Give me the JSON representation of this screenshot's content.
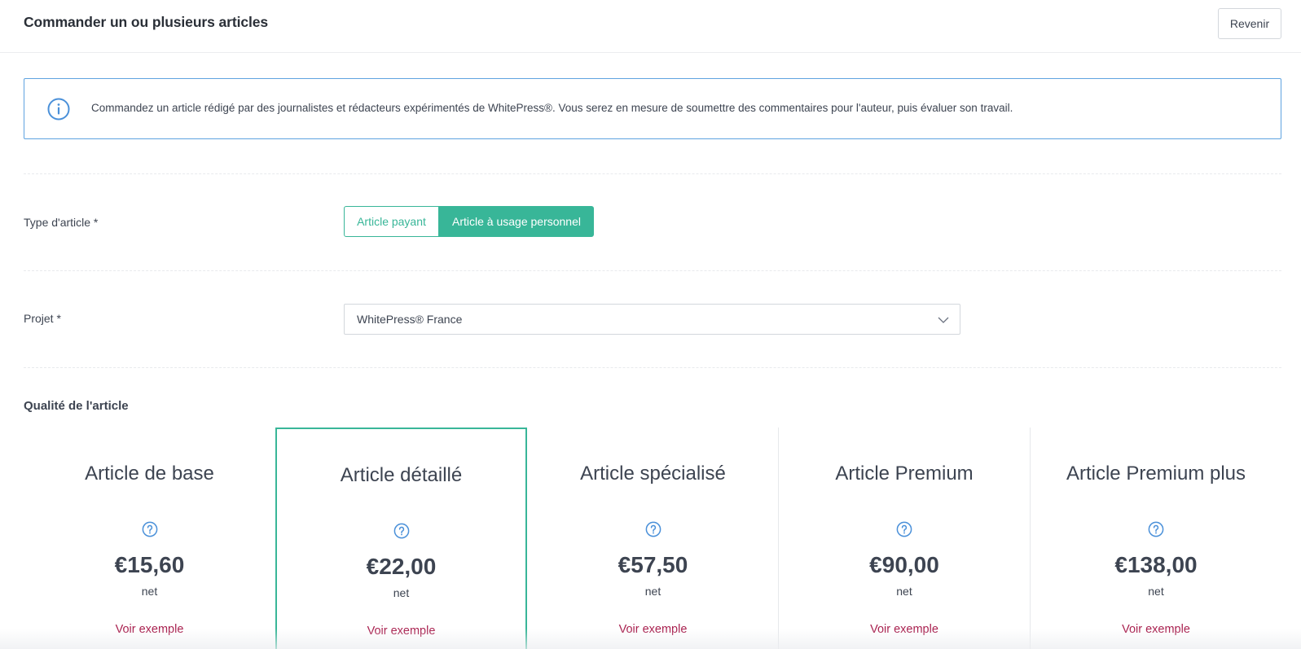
{
  "header": {
    "title": "Commander un ou plusieurs articles",
    "back_label": "Revenir"
  },
  "info": {
    "icon": "info-circle-icon",
    "text": "Commandez un article rédigé par des journalistes et rédacteurs expérimentés de WhitePress®. Vous serez en mesure de soumettre des commentaires pour l'auteur, puis évaluer son travail."
  },
  "article_type": {
    "label": "Type d'article *",
    "options": [
      "Article payant",
      "Article à usage personnel"
    ],
    "selected": "Article à usage personnel"
  },
  "project": {
    "label": "Projet *",
    "value": "WhitePress® France"
  },
  "quality": {
    "title": "Qualité de l'article",
    "cards": [
      {
        "title": "Article de base",
        "price": "€15,60",
        "net": "net",
        "link": "Voir exemple"
      },
      {
        "title": "Article détaillé",
        "price": "€22,00",
        "net": "net",
        "link": "Voir exemple"
      },
      {
        "title": "Article spécialisé",
        "price": "€57,50",
        "net": "net",
        "link": "Voir exemple"
      },
      {
        "title": "Article Premium",
        "price": "€90,00",
        "net": "net",
        "link": "Voir exemple"
      },
      {
        "title": "Article Premium plus",
        "price": "€138,00",
        "net": "net",
        "link": "Voir exemple"
      }
    ],
    "selected_card": "Article détaillé"
  },
  "colors": {
    "accent": "#38b698",
    "info_border": "#5fa3e0",
    "link": "#a81e4d",
    "text": "#3d4451"
  }
}
